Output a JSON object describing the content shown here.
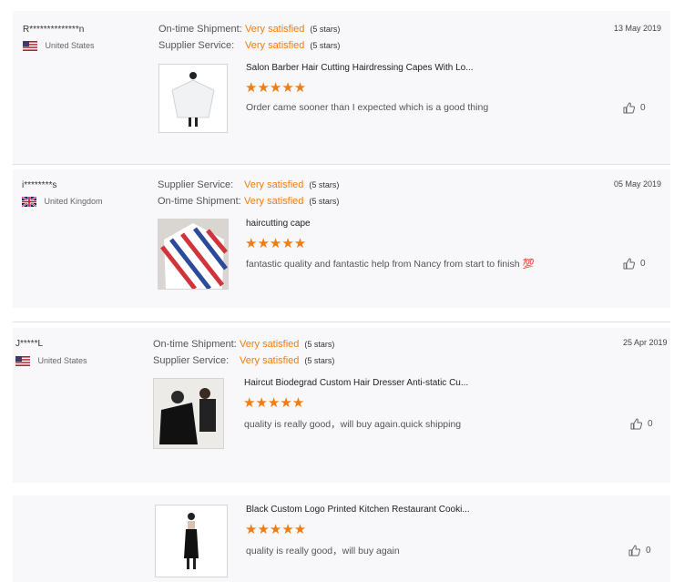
{
  "reviews": [
    {
      "buyer": "R**************n",
      "country": "United States",
      "flag": "us",
      "date": "13 May 2019",
      "ratings": [
        {
          "label": "On-time Shipment:",
          "value": "Very satisfied",
          "stars": "(5 stars)"
        },
        {
          "label": "Supplier Service:",
          "value": "Very satisfied",
          "stars": "(5 stars)"
        }
      ],
      "product_title": "Salon Barber Hair Cutting Hairdressing Capes With Lo...",
      "stars": "★★★★★",
      "comment": "Order came sooner than I expected which is a good thing",
      "likes": "0"
    },
    {
      "buyer": "i********s",
      "country": "United Kingdom",
      "flag": "uk",
      "date": "05 May 2019",
      "ratings": [
        {
          "label": "Supplier Service:",
          "value": "Very satisfied",
          "stars": "(5 stars)"
        },
        {
          "label": "On-time Shipment:",
          "value": "Very satisfied",
          "stars": "(5 stars)"
        }
      ],
      "product_title": "haircutting cape",
      "stars": "★★★★★",
      "comment": "fantastic quality and fantastic help from Nancy from start to finish 💯",
      "likes": "0"
    },
    {
      "buyer": "J*****L",
      "country": "United States",
      "flag": "us",
      "date": "25 Apr 2019",
      "ratings": [
        {
          "label": "On-time Shipment:",
          "value": "Very satisfied",
          "stars": "(5 stars)"
        },
        {
          "label": "Supplier Service:",
          "value": "Very satisfied",
          "stars": "(5 stars)"
        }
      ],
      "product_title": "Haircut Biodegrad Custom Hair Dresser Anti-static Cu...",
      "stars": "★★★★★",
      "comment": "quality is really good，will buy again.quick shipping",
      "likes": "0"
    },
    {
      "product_title": "Black Custom Logo Printed Kitchen Restaurant Cooki...",
      "stars": "★★★★★",
      "comment": "quality is really good，will buy again",
      "likes": "0"
    }
  ],
  "colors": {
    "accent": "#f07c12",
    "background": "#f8f8fa"
  }
}
